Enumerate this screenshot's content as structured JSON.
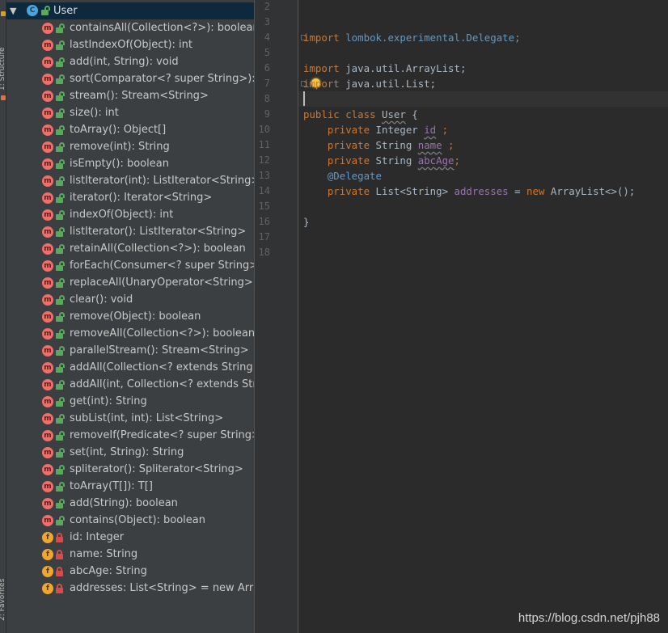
{
  "stripe": {
    "top_label": "1: Structure",
    "bottom_label": "2: Favorites"
  },
  "structure": {
    "class_badge": "C",
    "class_name": "User",
    "members": [
      {
        "kind": "method",
        "badge": "m",
        "access": "public",
        "label": "containsAll(Collection<?>): boolean"
      },
      {
        "kind": "method",
        "badge": "m",
        "access": "public",
        "label": "lastIndexOf(Object): int"
      },
      {
        "kind": "method",
        "badge": "m",
        "access": "public",
        "label": "add(int, String): void"
      },
      {
        "kind": "method",
        "badge": "m",
        "access": "public",
        "label": "sort(Comparator<? super String>): void"
      },
      {
        "kind": "method",
        "badge": "m",
        "access": "public",
        "label": "stream(): Stream<String>"
      },
      {
        "kind": "method",
        "badge": "m",
        "access": "public",
        "label": "size(): int"
      },
      {
        "kind": "method",
        "badge": "m",
        "access": "public",
        "label": "toArray(): Object[]"
      },
      {
        "kind": "method",
        "badge": "m",
        "access": "public",
        "label": "remove(int): String"
      },
      {
        "kind": "method",
        "badge": "m",
        "access": "public",
        "label": "isEmpty(): boolean"
      },
      {
        "kind": "method",
        "badge": "m",
        "access": "public",
        "label": "listIterator(int): ListIterator<String>"
      },
      {
        "kind": "method",
        "badge": "m",
        "access": "public",
        "label": "iterator(): Iterator<String>"
      },
      {
        "kind": "method",
        "badge": "m",
        "access": "public",
        "label": "indexOf(Object): int"
      },
      {
        "kind": "method",
        "badge": "m",
        "access": "public",
        "label": "listIterator(): ListIterator<String>"
      },
      {
        "kind": "method",
        "badge": "m",
        "access": "public",
        "label": "retainAll(Collection<?>): boolean"
      },
      {
        "kind": "method",
        "badge": "m",
        "access": "public",
        "label": "forEach(Consumer<? super String>): void"
      },
      {
        "kind": "method",
        "badge": "m",
        "access": "public",
        "label": "replaceAll(UnaryOperator<String>): void"
      },
      {
        "kind": "method",
        "badge": "m",
        "access": "public",
        "label": "clear(): void"
      },
      {
        "kind": "method",
        "badge": "m",
        "access": "public",
        "label": "remove(Object): boolean"
      },
      {
        "kind": "method",
        "badge": "m",
        "access": "public",
        "label": "removeAll(Collection<?>): boolean"
      },
      {
        "kind": "method",
        "badge": "m",
        "access": "public",
        "label": "parallelStream(): Stream<String>"
      },
      {
        "kind": "method",
        "badge": "m",
        "access": "public",
        "label": "addAll(Collection<? extends String>): boolean"
      },
      {
        "kind": "method",
        "badge": "m",
        "access": "public",
        "label": "addAll(int, Collection<? extends String>): boolean"
      },
      {
        "kind": "method",
        "badge": "m",
        "access": "public",
        "label": "get(int): String"
      },
      {
        "kind": "method",
        "badge": "m",
        "access": "public",
        "label": "subList(int, int): List<String>"
      },
      {
        "kind": "method",
        "badge": "m",
        "access": "public",
        "label": "removeIf(Predicate<? super String>): boolean"
      },
      {
        "kind": "method",
        "badge": "m",
        "access": "public",
        "label": "set(int, String): String"
      },
      {
        "kind": "method",
        "badge": "m",
        "access": "public",
        "label": "spliterator(): Spliterator<String>"
      },
      {
        "kind": "method",
        "badge": "m",
        "access": "public",
        "label": "toArray(T[]): T[]"
      },
      {
        "kind": "method",
        "badge": "m",
        "access": "public",
        "label": "add(String): boolean"
      },
      {
        "kind": "method",
        "badge": "m",
        "access": "public",
        "label": "contains(Object): boolean"
      },
      {
        "kind": "field",
        "badge": "f",
        "access": "private",
        "label": "id: Integer"
      },
      {
        "kind": "field",
        "badge": "f",
        "access": "private",
        "label": "name: String"
      },
      {
        "kind": "field",
        "badge": "f",
        "access": "private",
        "label": "abcAge: String"
      },
      {
        "kind": "field",
        "badge": "f",
        "access": "private",
        "label": "addresses: List<String> = new ArrayList<>()"
      }
    ]
  },
  "editor": {
    "line_numbers": [
      "2",
      "3",
      "4",
      "5",
      "6",
      "7",
      "8",
      "9",
      "10",
      "11",
      "12",
      "13",
      "14",
      "15",
      "16",
      "17",
      "18"
    ],
    "code": {
      "l4_kw": "import",
      "l4_pkg": " lombok.experimental.Delegate;",
      "l6_kw": "import",
      "l6_pkg": " java.util.ArrayList;",
      "l7_kw": "import",
      "l7_pkg": " java.util.List;",
      "l9_kw1": "public",
      "l9_kw2": " class ",
      "l9_name": "User",
      "l9_brace": " {",
      "l10_kw": "private",
      "l10_type": " Integer ",
      "l10_field": "id",
      "l10_end": " ;",
      "l11_kw": "private",
      "l11_type": " String ",
      "l11_field": "name",
      "l11_end": " ;",
      "l12_kw": "private",
      "l12_type": " String ",
      "l12_field": "abcAge",
      "l12_end": ";",
      "l13_ann": "@Delegate",
      "l14_kw": "private",
      "l14_type": " List<String> ",
      "l14_field": "addresses",
      "l14_eq": " = ",
      "l14_new": "new",
      "l14_rest": " ArrayList<>();",
      "l16_brace": "}"
    }
  },
  "watermark": "https://blog.csdn.net/pjh88"
}
